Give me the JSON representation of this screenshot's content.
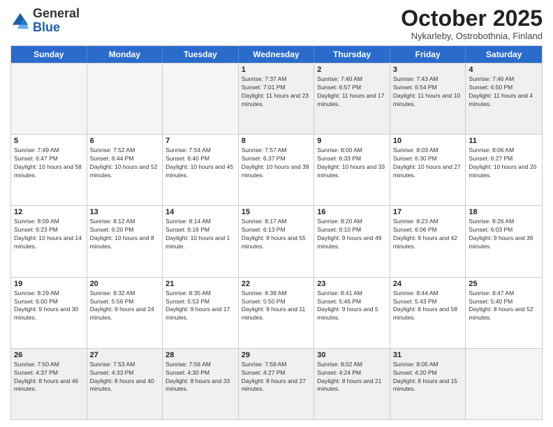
{
  "header": {
    "logo_general": "General",
    "logo_blue": "Blue",
    "month_title": "October 2025",
    "location": "Nykarleby, Ostrobothnia, Finland"
  },
  "weekdays": [
    "Sunday",
    "Monday",
    "Tuesday",
    "Wednesday",
    "Thursday",
    "Friday",
    "Saturday"
  ],
  "weeks": [
    [
      {
        "day": "",
        "sunrise": "",
        "sunset": "",
        "daylight": "",
        "empty": true
      },
      {
        "day": "",
        "sunrise": "",
        "sunset": "",
        "daylight": "",
        "empty": true
      },
      {
        "day": "",
        "sunrise": "",
        "sunset": "",
        "daylight": "",
        "empty": true
      },
      {
        "day": "1",
        "sunrise": "Sunrise: 7:37 AM",
        "sunset": "Sunset: 7:01 PM",
        "daylight": "Daylight: 11 hours and 23 minutes.",
        "empty": false
      },
      {
        "day": "2",
        "sunrise": "Sunrise: 7:40 AM",
        "sunset": "Sunset: 6:57 PM",
        "daylight": "Daylight: 11 hours and 17 minutes.",
        "empty": false
      },
      {
        "day": "3",
        "sunrise": "Sunrise: 7:43 AM",
        "sunset": "Sunset: 6:54 PM",
        "daylight": "Daylight: 11 hours and 10 minutes.",
        "empty": false
      },
      {
        "day": "4",
        "sunrise": "Sunrise: 7:46 AM",
        "sunset": "Sunset: 6:50 PM",
        "daylight": "Daylight: 11 hours and 4 minutes.",
        "empty": false
      }
    ],
    [
      {
        "day": "5",
        "sunrise": "Sunrise: 7:49 AM",
        "sunset": "Sunset: 6:47 PM",
        "daylight": "Daylight: 10 hours and 58 minutes.",
        "empty": false
      },
      {
        "day": "6",
        "sunrise": "Sunrise: 7:52 AM",
        "sunset": "Sunset: 6:44 PM",
        "daylight": "Daylight: 10 hours and 52 minutes.",
        "empty": false
      },
      {
        "day": "7",
        "sunrise": "Sunrise: 7:54 AM",
        "sunset": "Sunset: 6:40 PM",
        "daylight": "Daylight: 10 hours and 45 minutes.",
        "empty": false
      },
      {
        "day": "8",
        "sunrise": "Sunrise: 7:57 AM",
        "sunset": "Sunset: 6:37 PM",
        "daylight": "Daylight: 10 hours and 39 minutes.",
        "empty": false
      },
      {
        "day": "9",
        "sunrise": "Sunrise: 8:00 AM",
        "sunset": "Sunset: 6:33 PM",
        "daylight": "Daylight: 10 hours and 33 minutes.",
        "empty": false
      },
      {
        "day": "10",
        "sunrise": "Sunrise: 8:03 AM",
        "sunset": "Sunset: 6:30 PM",
        "daylight": "Daylight: 10 hours and 27 minutes.",
        "empty": false
      },
      {
        "day": "11",
        "sunrise": "Sunrise: 8:06 AM",
        "sunset": "Sunset: 6:27 PM",
        "daylight": "Daylight: 10 hours and 20 minutes.",
        "empty": false
      }
    ],
    [
      {
        "day": "12",
        "sunrise": "Sunrise: 8:09 AM",
        "sunset": "Sunset: 6:23 PM",
        "daylight": "Daylight: 10 hours and 14 minutes.",
        "empty": false
      },
      {
        "day": "13",
        "sunrise": "Sunrise: 8:12 AM",
        "sunset": "Sunset: 6:20 PM",
        "daylight": "Daylight: 10 hours and 8 minutes.",
        "empty": false
      },
      {
        "day": "14",
        "sunrise": "Sunrise: 8:14 AM",
        "sunset": "Sunset: 6:16 PM",
        "daylight": "Daylight: 10 hours and 1 minute.",
        "empty": false
      },
      {
        "day": "15",
        "sunrise": "Sunrise: 8:17 AM",
        "sunset": "Sunset: 6:13 PM",
        "daylight": "Daylight: 9 hours and 55 minutes.",
        "empty": false
      },
      {
        "day": "16",
        "sunrise": "Sunrise: 8:20 AM",
        "sunset": "Sunset: 6:10 PM",
        "daylight": "Daylight: 9 hours and 49 minutes.",
        "empty": false
      },
      {
        "day": "17",
        "sunrise": "Sunrise: 8:23 AM",
        "sunset": "Sunset: 6:06 PM",
        "daylight": "Daylight: 9 hours and 42 minutes.",
        "empty": false
      },
      {
        "day": "18",
        "sunrise": "Sunrise: 8:26 AM",
        "sunset": "Sunset: 6:03 PM",
        "daylight": "Daylight: 9 hours and 36 minutes.",
        "empty": false
      }
    ],
    [
      {
        "day": "19",
        "sunrise": "Sunrise: 8:29 AM",
        "sunset": "Sunset: 6:00 PM",
        "daylight": "Daylight: 9 hours and 30 minutes.",
        "empty": false
      },
      {
        "day": "20",
        "sunrise": "Sunrise: 8:32 AM",
        "sunset": "Sunset: 5:56 PM",
        "daylight": "Daylight: 9 hours and 24 minutes.",
        "empty": false
      },
      {
        "day": "21",
        "sunrise": "Sunrise: 8:35 AM",
        "sunset": "Sunset: 5:53 PM",
        "daylight": "Daylight: 9 hours and 17 minutes.",
        "empty": false
      },
      {
        "day": "22",
        "sunrise": "Sunrise: 8:38 AM",
        "sunset": "Sunset: 5:50 PM",
        "daylight": "Daylight: 9 hours and 11 minutes.",
        "empty": false
      },
      {
        "day": "23",
        "sunrise": "Sunrise: 8:41 AM",
        "sunset": "Sunset: 5:46 PM",
        "daylight": "Daylight: 9 hours and 5 minutes.",
        "empty": false
      },
      {
        "day": "24",
        "sunrise": "Sunrise: 8:44 AM",
        "sunset": "Sunset: 5:43 PM",
        "daylight": "Daylight: 8 hours and 58 minutes.",
        "empty": false
      },
      {
        "day": "25",
        "sunrise": "Sunrise: 8:47 AM",
        "sunset": "Sunset: 5:40 PM",
        "daylight": "Daylight: 8 hours and 52 minutes.",
        "empty": false
      }
    ],
    [
      {
        "day": "26",
        "sunrise": "Sunrise: 7:50 AM",
        "sunset": "Sunset: 4:37 PM",
        "daylight": "Daylight: 8 hours and 46 minutes.",
        "empty": false
      },
      {
        "day": "27",
        "sunrise": "Sunrise: 7:53 AM",
        "sunset": "Sunset: 4:33 PM",
        "daylight": "Daylight: 8 hours and 40 minutes.",
        "empty": false
      },
      {
        "day": "28",
        "sunrise": "Sunrise: 7:56 AM",
        "sunset": "Sunset: 4:30 PM",
        "daylight": "Daylight: 8 hours and 33 minutes.",
        "empty": false
      },
      {
        "day": "29",
        "sunrise": "Sunrise: 7:59 AM",
        "sunset": "Sunset: 4:27 PM",
        "daylight": "Daylight: 8 hours and 27 minutes.",
        "empty": false
      },
      {
        "day": "30",
        "sunrise": "Sunrise: 8:02 AM",
        "sunset": "Sunset: 4:24 PM",
        "daylight": "Daylight: 8 hours and 21 minutes.",
        "empty": false
      },
      {
        "day": "31",
        "sunrise": "Sunrise: 8:05 AM",
        "sunset": "Sunset: 4:20 PM",
        "daylight": "Daylight: 8 hours and 15 minutes.",
        "empty": false
      },
      {
        "day": "",
        "sunrise": "",
        "sunset": "",
        "daylight": "",
        "empty": true
      }
    ]
  ]
}
